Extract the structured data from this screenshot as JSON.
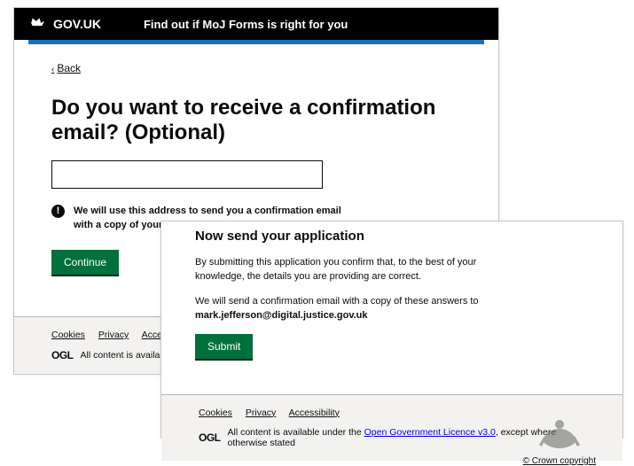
{
  "header": {
    "brand": "GOV.UK",
    "service": "Find out if MoJ Forms is right for you"
  },
  "back": "Back",
  "heading": "Do you want to receive a confirmation email? (Optional)",
  "hint": "We will use this address to send you a confirmation email with a copy of your answers.",
  "continue_label": "Continue",
  "page2": {
    "heading": "Now send your application",
    "p1": "By submitting this application you confirm that, to the best of your knowledge, the details you are providing are correct.",
    "p2_a": "We will send a confirmation email with a copy of these answers to",
    "email": "mark.jefferson@digital.justice.gov.uk",
    "submit_label": "Submit"
  },
  "footer": {
    "cookies": "Cookies",
    "privacy": "Privacy",
    "accessibility": "Accessibility",
    "ogl": "OGL",
    "licence_a": "All content is available under the ",
    "licence_link": "Open Government Licence v3.0",
    "licence_b": ", except where otherwise stated",
    "trunc": "All content is available u",
    "crown": "© Crown copyright"
  }
}
